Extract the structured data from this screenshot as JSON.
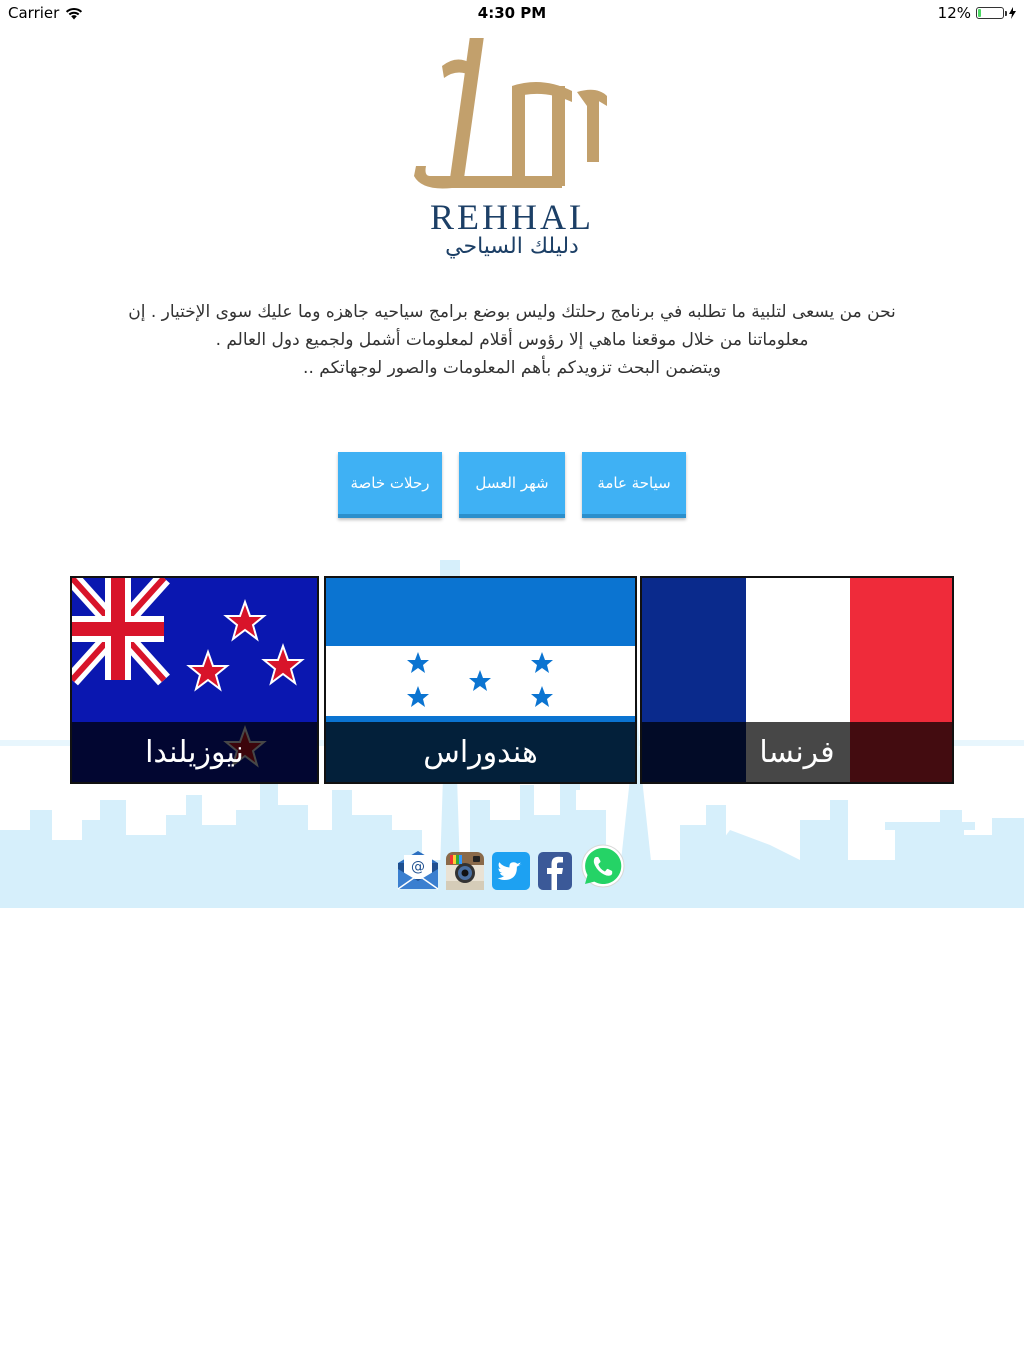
{
  "status_bar": {
    "carrier": "Carrier",
    "time": "4:30 PM",
    "battery": "12%",
    "battery_level": 0.12
  },
  "logo": {
    "name": "REHHAL",
    "tagline": "دليلك السياحي"
  },
  "intro": {
    "line1": "نحن من يسعى لتلبية ما تطلبه في برنامج رحلتك وليس بوضع برامج سياحيه جاهزه وما عليك سوى الإختيار . إن",
    "line2": "معلوماتنا من خلال موقعنا ماهي إلا رؤوس أقلام لمعلومات أشمل ولجميع دول العالم .",
    "line3": "ويتضمن البحث تزويدكم بأهم المعلومات والصور لوجهاتكم .."
  },
  "categories": [
    {
      "label": "سياحة عامة"
    },
    {
      "label": "شهر العسل"
    },
    {
      "label": "رحلات خاصة"
    }
  ],
  "countries": [
    {
      "name": "فرنسا",
      "flag": "france-flag-icon"
    },
    {
      "name": "هندوراس",
      "flag": "honduras-flag-icon"
    },
    {
      "name": "نيوزيلندا",
      "flag": "new-zealand-flag-icon"
    }
  ],
  "social": [
    {
      "icon": "whatsapp-icon",
      "color": "#25d366"
    },
    {
      "icon": "facebook-icon",
      "color": "#3b5998"
    },
    {
      "icon": "twitter-icon",
      "color": "#1da1f2"
    },
    {
      "icon": "instagram-icon",
      "color": "#8a6a4a"
    },
    {
      "icon": "email-icon",
      "color": "#1e4f8f"
    }
  ],
  "colors": {
    "button": "#3fb1f4",
    "logo_gold": "#c2a06c",
    "logo_navy": "#1c3f66",
    "skyline": "#d6effb"
  }
}
